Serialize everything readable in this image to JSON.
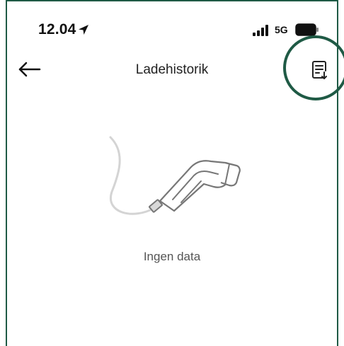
{
  "status_bar": {
    "time": "12.04",
    "network": "5G",
    "icons": [
      "location-arrow-icon",
      "signal-icon",
      "battery-icon"
    ]
  },
  "header": {
    "title": "Ladehistorik",
    "back_icon": "arrow-left-icon",
    "export_icon": "document-download-icon"
  },
  "empty_state": {
    "illustration": "charging-plug-icon",
    "label": "Ingen data"
  },
  "colors": {
    "frame": "#1f5a45",
    "highlight": "#1f5a45",
    "text": "#222222",
    "muted": "#555555"
  }
}
